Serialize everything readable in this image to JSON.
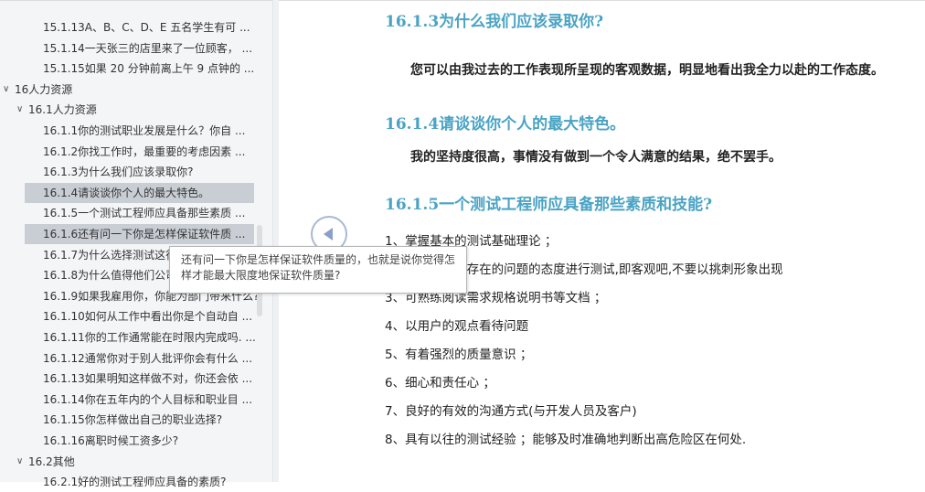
{
  "sidebar": {
    "items": [
      {
        "label": "15.1.13A、B、C、D、E 五名学生有可 ...",
        "level": 3
      },
      {
        "label": "15.1.14一天张三的店里来了一位顾客， ...",
        "level": 3
      },
      {
        "label": "15.1.15如果 20 分钟前离上午 9 点钟的 ...",
        "level": 3
      },
      {
        "label": "16人力资源",
        "level": 1
      },
      {
        "label": "16.1人力资源",
        "level": 2
      },
      {
        "label": "16.1.1你的测试职业发展是什么？你自 ...",
        "level": 3
      },
      {
        "label": "16.1.2你找工作时，最重要的考虑因素 ...",
        "level": 3
      },
      {
        "label": "16.1.3为什么我们应该录取你?",
        "level": 3
      },
      {
        "label": "16.1.4请谈谈你个人的最大特色。",
        "level": 3,
        "selected": true
      },
      {
        "label": "16.1.5一个测试工程师应具备那些素质 ...",
        "level": 3
      },
      {
        "label": "16.1.6还有问一下你是怎样保证软件质 ...",
        "level": 3,
        "selected": true
      },
      {
        "label": "16.1.7为什么选择测试这行?",
        "level": 3
      },
      {
        "label": "16.1.8为什么值得他们公司雇用?",
        "level": 3
      },
      {
        "label": "16.1.9如果我雇用你，你能为部门带来什么?",
        "level": 3
      },
      {
        "label": "16.1.10如何从工作中看出你是个自动自 ...",
        "level": 3
      },
      {
        "label": "16.1.11你的工作通常能在时限内完成吗. ...",
        "level": 3
      },
      {
        "label": "16.1.12通常你对于别人批评你会有什么 ...",
        "level": 3
      },
      {
        "label": "16.1.13如果明知这样做不对，你还会依 ...",
        "level": 3
      },
      {
        "label": "16.1.14你在五年内的个人目标和职业目 ...",
        "level": 3
      },
      {
        "label": "16.1.15你怎样做出自己的职业选择?",
        "level": 3
      },
      {
        "label": "16.1.16离职时候工资多少?",
        "level": 3
      },
      {
        "label": "16.2其他",
        "level": 2
      },
      {
        "label": "16.2.1好的测试工程师应具备的素质?",
        "level": 3
      }
    ]
  },
  "content": {
    "h1": "16.1.3为什么我们应该录取你?",
    "p1": "您可以由我过去的工作表现所呈现的客观数据，明显地看出我全力以赴的工作态度。",
    "h2": "16.1.4请谈谈你个人的最大特色。",
    "p2": "我的坚持度很高，事情没有做到一个令人满意的结果，绝不罢手。",
    "h3": "16.1.5一个测试工程师应具备那些素质和技能?",
    "list": [
      "1、掌握基本的测试基础理论 ；",
      "2、以怀疑软件存在的问题的态度进行测试,即客观吧,不要以挑刺形象出现",
      "3、可熟练阅读需求规格说明书等文档 ；",
      "4、以用户的观点看待问题",
      "5、有着强烈的质量意识 ；",
      "6、细心和责任心 ；",
      "7、良好的有效的沟通方式(与开发人员及客户)",
      "8、具有以往的测试经验 ；能够及时准确地判断出高危险区在何处."
    ]
  },
  "tooltip": "还有问一下你是怎样保证软件质量的，也就是说你觉得怎样才能最大限度地保证软件质量?",
  "colors": {
    "heading": "#4aa3c4",
    "selected": "#c9ced5"
  }
}
